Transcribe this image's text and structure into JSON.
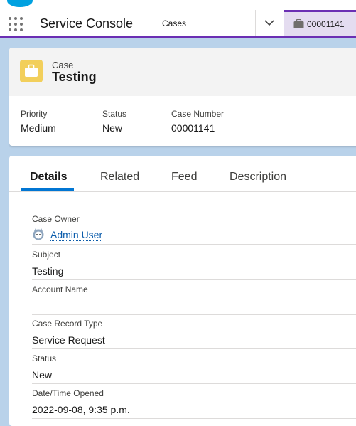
{
  "app": {
    "name": "Service Console"
  },
  "nav": {
    "objects_tab": "Cases",
    "record_tab": "00001141"
  },
  "header": {
    "object_label": "Case",
    "title": "Testing",
    "fields": [
      {
        "label": "Priority",
        "value": "Medium"
      },
      {
        "label": "Status",
        "value": "New"
      },
      {
        "label": "Case Number",
        "value": "00001141"
      }
    ]
  },
  "tabs": [
    "Details",
    "Related",
    "Feed",
    "Description"
  ],
  "details": [
    {
      "label": "Case Owner",
      "value": "Admin User"
    },
    {
      "label": "Subject",
      "value": "Testing"
    },
    {
      "label": "Account Name",
      "value": ""
    },
    {
      "label": "Case Record Type",
      "value": "Service Request"
    },
    {
      "label": "Status",
      "value": "New"
    },
    {
      "label": "Date/Time Opened",
      "value": "2022-09-08, 9:35 p.m."
    }
  ],
  "colors": {
    "accent": "#6b2fb3",
    "case_icon": "#f2cf5b",
    "link": "#0b5cab",
    "active_tab": "#0176d3"
  }
}
